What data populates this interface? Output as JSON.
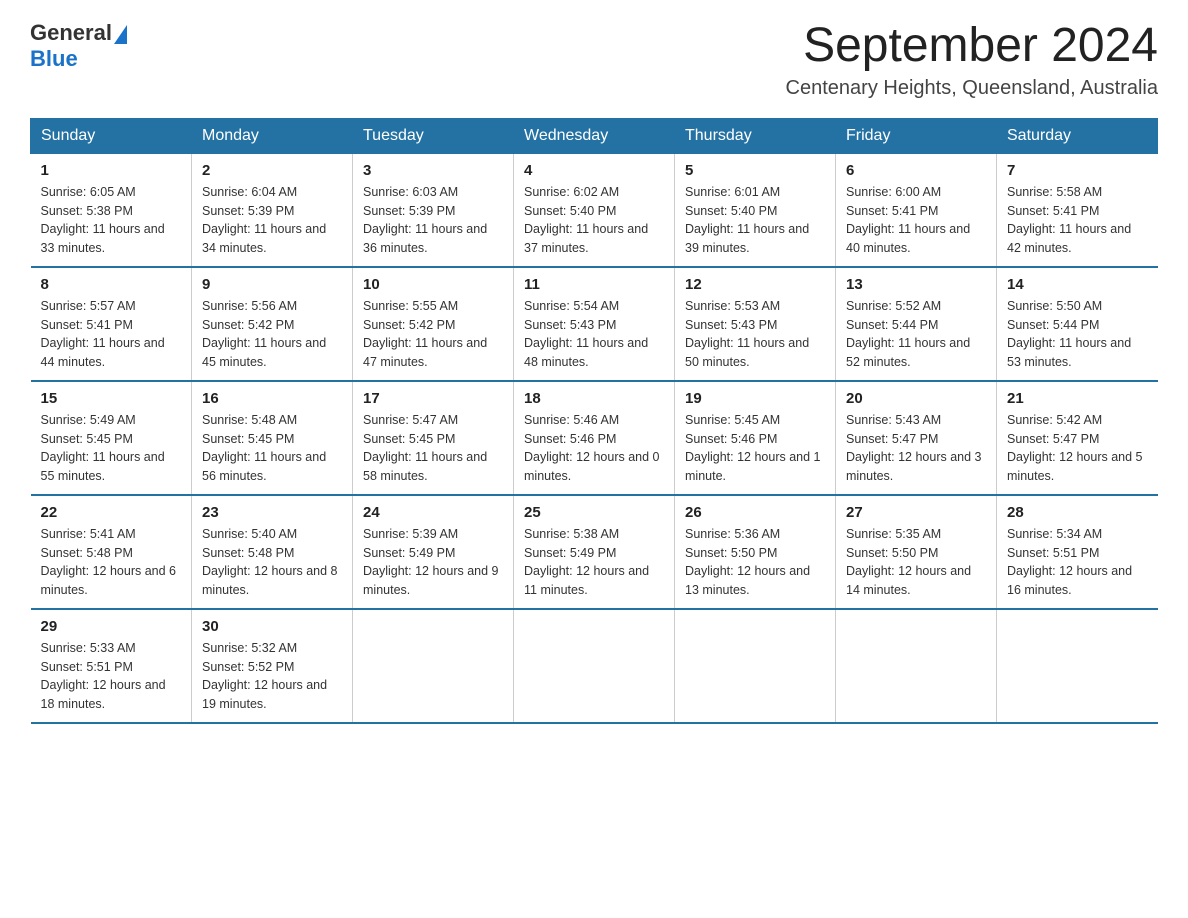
{
  "header": {
    "logo_general": "General",
    "logo_blue": "Blue",
    "month_title": "September 2024",
    "location": "Centenary Heights, Queensland, Australia"
  },
  "days_of_week": [
    "Sunday",
    "Monday",
    "Tuesday",
    "Wednesday",
    "Thursday",
    "Friday",
    "Saturday"
  ],
  "weeks": [
    [
      {
        "day": "1",
        "sunrise": "6:05 AM",
        "sunset": "5:38 PM",
        "daylight": "11 hours and 33 minutes."
      },
      {
        "day": "2",
        "sunrise": "6:04 AM",
        "sunset": "5:39 PM",
        "daylight": "11 hours and 34 minutes."
      },
      {
        "day": "3",
        "sunrise": "6:03 AM",
        "sunset": "5:39 PM",
        "daylight": "11 hours and 36 minutes."
      },
      {
        "day": "4",
        "sunrise": "6:02 AM",
        "sunset": "5:40 PM",
        "daylight": "11 hours and 37 minutes."
      },
      {
        "day": "5",
        "sunrise": "6:01 AM",
        "sunset": "5:40 PM",
        "daylight": "11 hours and 39 minutes."
      },
      {
        "day": "6",
        "sunrise": "6:00 AM",
        "sunset": "5:41 PM",
        "daylight": "11 hours and 40 minutes."
      },
      {
        "day": "7",
        "sunrise": "5:58 AM",
        "sunset": "5:41 PM",
        "daylight": "11 hours and 42 minutes."
      }
    ],
    [
      {
        "day": "8",
        "sunrise": "5:57 AM",
        "sunset": "5:41 PM",
        "daylight": "11 hours and 44 minutes."
      },
      {
        "day": "9",
        "sunrise": "5:56 AM",
        "sunset": "5:42 PM",
        "daylight": "11 hours and 45 minutes."
      },
      {
        "day": "10",
        "sunrise": "5:55 AM",
        "sunset": "5:42 PM",
        "daylight": "11 hours and 47 minutes."
      },
      {
        "day": "11",
        "sunrise": "5:54 AM",
        "sunset": "5:43 PM",
        "daylight": "11 hours and 48 minutes."
      },
      {
        "day": "12",
        "sunrise": "5:53 AM",
        "sunset": "5:43 PM",
        "daylight": "11 hours and 50 minutes."
      },
      {
        "day": "13",
        "sunrise": "5:52 AM",
        "sunset": "5:44 PM",
        "daylight": "11 hours and 52 minutes."
      },
      {
        "day": "14",
        "sunrise": "5:50 AM",
        "sunset": "5:44 PM",
        "daylight": "11 hours and 53 minutes."
      }
    ],
    [
      {
        "day": "15",
        "sunrise": "5:49 AM",
        "sunset": "5:45 PM",
        "daylight": "11 hours and 55 minutes."
      },
      {
        "day": "16",
        "sunrise": "5:48 AM",
        "sunset": "5:45 PM",
        "daylight": "11 hours and 56 minutes."
      },
      {
        "day": "17",
        "sunrise": "5:47 AM",
        "sunset": "5:45 PM",
        "daylight": "11 hours and 58 minutes."
      },
      {
        "day": "18",
        "sunrise": "5:46 AM",
        "sunset": "5:46 PM",
        "daylight": "12 hours and 0 minutes."
      },
      {
        "day": "19",
        "sunrise": "5:45 AM",
        "sunset": "5:46 PM",
        "daylight": "12 hours and 1 minute."
      },
      {
        "day": "20",
        "sunrise": "5:43 AM",
        "sunset": "5:47 PM",
        "daylight": "12 hours and 3 minutes."
      },
      {
        "day": "21",
        "sunrise": "5:42 AM",
        "sunset": "5:47 PM",
        "daylight": "12 hours and 5 minutes."
      }
    ],
    [
      {
        "day": "22",
        "sunrise": "5:41 AM",
        "sunset": "5:48 PM",
        "daylight": "12 hours and 6 minutes."
      },
      {
        "day": "23",
        "sunrise": "5:40 AM",
        "sunset": "5:48 PM",
        "daylight": "12 hours and 8 minutes."
      },
      {
        "day": "24",
        "sunrise": "5:39 AM",
        "sunset": "5:49 PM",
        "daylight": "12 hours and 9 minutes."
      },
      {
        "day": "25",
        "sunrise": "5:38 AM",
        "sunset": "5:49 PM",
        "daylight": "12 hours and 11 minutes."
      },
      {
        "day": "26",
        "sunrise": "5:36 AM",
        "sunset": "5:50 PM",
        "daylight": "12 hours and 13 minutes."
      },
      {
        "day": "27",
        "sunrise": "5:35 AM",
        "sunset": "5:50 PM",
        "daylight": "12 hours and 14 minutes."
      },
      {
        "day": "28",
        "sunrise": "5:34 AM",
        "sunset": "5:51 PM",
        "daylight": "12 hours and 16 minutes."
      }
    ],
    [
      {
        "day": "29",
        "sunrise": "5:33 AM",
        "sunset": "5:51 PM",
        "daylight": "12 hours and 18 minutes."
      },
      {
        "day": "30",
        "sunrise": "5:32 AM",
        "sunset": "5:52 PM",
        "daylight": "12 hours and 19 minutes."
      },
      null,
      null,
      null,
      null,
      null
    ]
  ],
  "labels": {
    "sunrise_prefix": "Sunrise: ",
    "sunset_prefix": "Sunset: ",
    "daylight_prefix": "Daylight: "
  }
}
